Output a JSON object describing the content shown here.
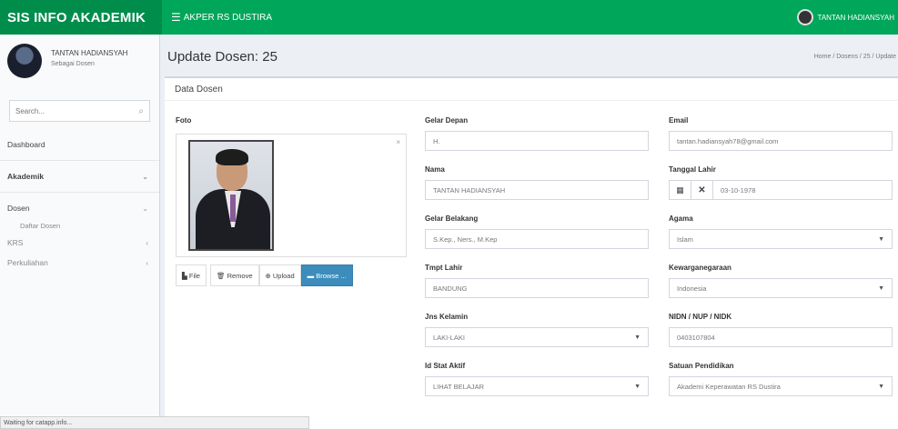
{
  "app": {
    "brand": "SIS INFO AKADEMIK",
    "nav_menu": "AKPER RS DUSTIRA",
    "user_name": "TANTAN HADIANSYAH"
  },
  "sidebar": {
    "user_name": "TANTAN HADIANSYAH",
    "user_role": "Sebagai Dosen",
    "search_placeholder": "Search...",
    "items": [
      {
        "label": "Dashboard"
      },
      {
        "label": "Akademik"
      },
      {
        "label": "Dosen"
      },
      {
        "label": "Daftar Dosen"
      },
      {
        "label": "KRS"
      },
      {
        "label": "Perkuliahan"
      }
    ]
  },
  "header": {
    "title": "Update Dosen: 25",
    "breadcrumb": "Home / Dosens / 25 / Update"
  },
  "box": {
    "title": "Data Dosen"
  },
  "photo": {
    "label": "Foto",
    "buttons": {
      "file": "File",
      "remove": "Remove",
      "upload": "Upload",
      "browse": "Browse ..."
    }
  },
  "form": {
    "gelar_depan": {
      "label": "Gelar Depan",
      "value": "H."
    },
    "nama": {
      "label": "Nama",
      "value": "TANTAN HADIANSYAH"
    },
    "gelar_belakang": {
      "label": "Gelar Belakang",
      "value": "S.Kep., Ners., M.Kep"
    },
    "tmpt_lahir": {
      "label": "Tmpt Lahir",
      "value": "BANDUNG"
    },
    "jns_kelamin": {
      "label": "Jns Kelamin",
      "value": "LAKI-LAKI"
    },
    "id_stat_aktif": {
      "label": "Id Stat Aktif",
      "value": "LIHAT BELAJAR"
    },
    "email": {
      "label": "Email",
      "value": "tantan.hadiansyah78@gmail.com"
    },
    "tanggal_lahir": {
      "label": "Tanggal Lahir",
      "value": "03-10-1978"
    },
    "agama": {
      "label": "Agama",
      "value": "Islam"
    },
    "kewarganegaraan": {
      "label": "Kewarganegaraan",
      "value": "Indonesia"
    },
    "nidn": {
      "label": "NIDN / NUP / NIDK",
      "value": "0403107804"
    },
    "satuan_pendidikan": {
      "label": "Satuan Pendidikan",
      "value": "Akademi Keperawatan RS Dustira"
    }
  },
  "status": {
    "text": "Waiting for catapp.info..."
  }
}
